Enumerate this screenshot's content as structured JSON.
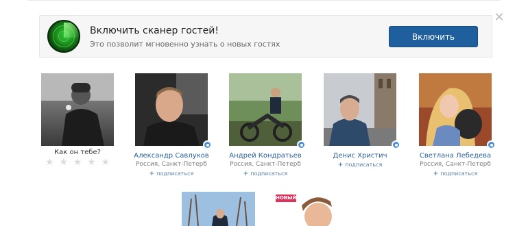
{
  "banner": {
    "title": "Включить сканер гостей!",
    "subtitle": "Это позволит мгновенно узнать о новых гостях",
    "button_label": "Включить",
    "close_glyph": "✕"
  },
  "rating": {
    "prompt": "Как он тебе?",
    "stars_total": 5,
    "stars_filled": 0
  },
  "profiles": [
    {
      "name": "Александр Савлуков",
      "city": "Россия, Санкт-Петерб",
      "subscribe": "подписаться"
    },
    {
      "name": "Андрей Кондратьев",
      "city": "Россия, Санкт-Петерб",
      "subscribe": "подписаться"
    },
    {
      "name": "Денис Христич",
      "city": "",
      "subscribe": "подписаться"
    },
    {
      "name": "Светлана Лебедева",
      "city": "Россия, Санкт-Петерб",
      "subscribe": "подписаться"
    }
  ],
  "bottom_row": {
    "new_badge": "НОВЫЙ"
  },
  "colors": {
    "accent": "#1f5f9e",
    "link": "#2a5f9a",
    "badge": "#4a90d9",
    "new_badge": "#e0325f"
  }
}
